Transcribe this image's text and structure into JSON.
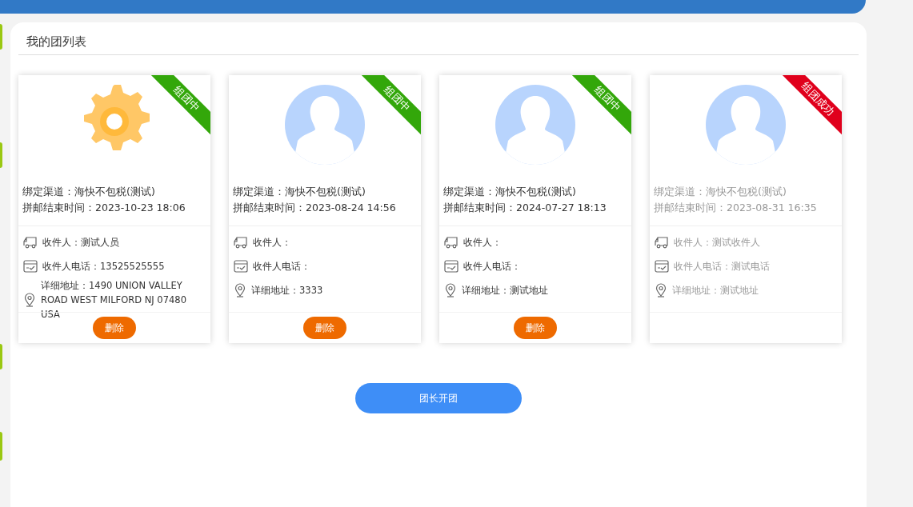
{
  "panel": {
    "title": "我的团列表"
  },
  "groups": [
    {
      "status": {
        "label": "组团中",
        "color": "#33a70a"
      },
      "avatar": {
        "kind": "gear"
      },
      "greyed": false,
      "channel": "绑定渠道：海快不包税(测试)",
      "end_time": "拼邮结束时间：2023-10-23 18:06",
      "recipient": "收件人：测试人员",
      "phone": "收件人电话：13525525555",
      "address": "详细地址：1490 UNION VALLEY ROAD WEST MILFORD NJ 07480 USA",
      "delete_label": "删除"
    },
    {
      "status": {
        "label": "组团中",
        "color": "#33a70a"
      },
      "avatar": {
        "kind": "person"
      },
      "greyed": false,
      "channel": "绑定渠道：海快不包税(测试)",
      "end_time": "拼邮结束时间：2023-08-24 14:56",
      "recipient": "收件人：",
      "phone": "收件人电话：",
      "address": "详细地址：3333",
      "delete_label": "删除"
    },
    {
      "status": {
        "label": "组团中",
        "color": "#33a70a"
      },
      "avatar": {
        "kind": "person"
      },
      "greyed": false,
      "channel": "绑定渠道：海快不包税(测试)",
      "end_time": "拼邮结束时间：2024-07-27 18:13",
      "recipient": "收件人：",
      "phone": "收件人电话：",
      "address": "详细地址：测试地址",
      "delete_label": "删除"
    },
    {
      "status": {
        "label": "组团成功",
        "color": "#e0001c"
      },
      "avatar": {
        "kind": "person"
      },
      "greyed": true,
      "channel": "绑定渠道：海快不包税(测试)",
      "end_time": "拼邮结束时间：2023-08-31 16:35",
      "recipient": "收件人：测试收件人",
      "phone": "收件人电话：测试电话",
      "address": "详细地址：测试地址"
    }
  ],
  "start_button": "团长开团"
}
